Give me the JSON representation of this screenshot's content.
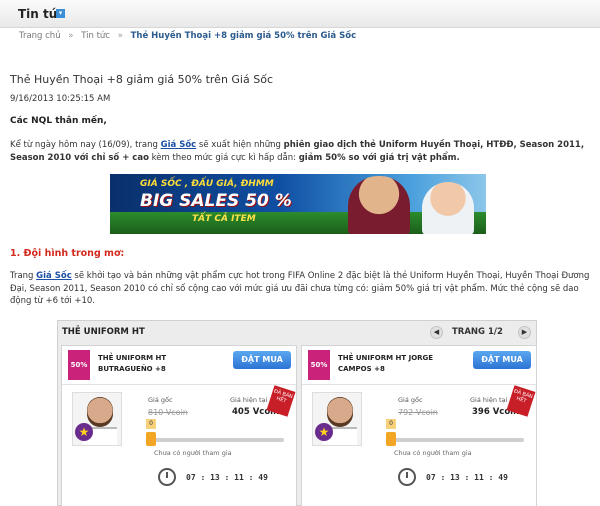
{
  "header": {
    "title": "Tin tức",
    "icon": "arrow-down-icon"
  },
  "breadcrumb": {
    "home": "Trang chủ",
    "sep": "»",
    "news": "Tin tức",
    "current": "Thẻ Huyền Thoại +8 giảm giá 50% trên Giá Sốc"
  },
  "article": {
    "title": "Thẻ Huyền Thoại +8 giảm giá 50% trên Giá Sốc",
    "date": "9/16/2013 10:25:15 AM",
    "greeting": "Các NQL thân mến,",
    "p1_a": "Kể từ ngày hôm nay (16/09), trang ",
    "p1_link": "Giá Sốc",
    "p1_b": " sẽ xuất hiện những ",
    "p1_bold1": "phiên giao dịch thẻ Uniform Huyền Thoại, HTĐĐ, Season 2011, Season 2010 với chỉ số + cao",
    "p1_c": " kèm theo mức giá cực kì hấp dẫn: ",
    "p1_bold2": "giảm 50% so với giá trị vật phẩm.",
    "section1": "1. Đội hình trong mơ:",
    "p2_a": "Trang ",
    "p2_link": "Giá Sốc",
    "p2_b": " sẽ khởi tạo và bán những vật phẩm cực hot trong FIFA Online 2 đặc biệt là thẻ Uniform Huyền Thoại, Huyền Thoại Đương Đại, Season 2011, Season 2010 có chỉ số cộng cao với mức giá ưu đãi chưa từng có: giảm 50% giá trị vật phẩm. Mức thẻ cộng sẽ dao động từ +6 tới +10."
  },
  "banner": {
    "line1": "GIÁ SỐC , ĐẤU GIÁ, ĐHMM",
    "line2": "BIG SALES 50 %",
    "line3": "TẤT CẢ ITEM"
  },
  "widget": {
    "title": "THẺ UNIFORM HT",
    "page": "TRANG 1/2",
    "cards": [
      {
        "badge": "50%",
        "name": "THẺ UNIFORM HT BUTRAGUEÑO +8",
        "buy": "ĐẶT MUA",
        "label_old": "Giá gốc",
        "old": "810 Vcoin",
        "label_cur": "Giá hiện tại",
        "cur": "405 Vcoin",
        "ribbon": "ĐÃ BÁN HẾT",
        "zero": "0",
        "note": "Chưa có người tham gia",
        "timer": "07 : 13 : 11 : 49"
      },
      {
        "badge": "50%",
        "name": "THẺ UNIFORM HT JORGE CAMPOS +8",
        "buy": "ĐẶT MUA",
        "label_old": "Giá gốc",
        "old": "792 Vcoin",
        "label_cur": "Giá hiện tại",
        "cur": "396 Vcoin",
        "ribbon": "ĐÃ BÁN HẾT",
        "zero": "0",
        "note": "Chưa có người tham gia",
        "timer": "07 : 13 : 11 : 49"
      }
    ]
  }
}
